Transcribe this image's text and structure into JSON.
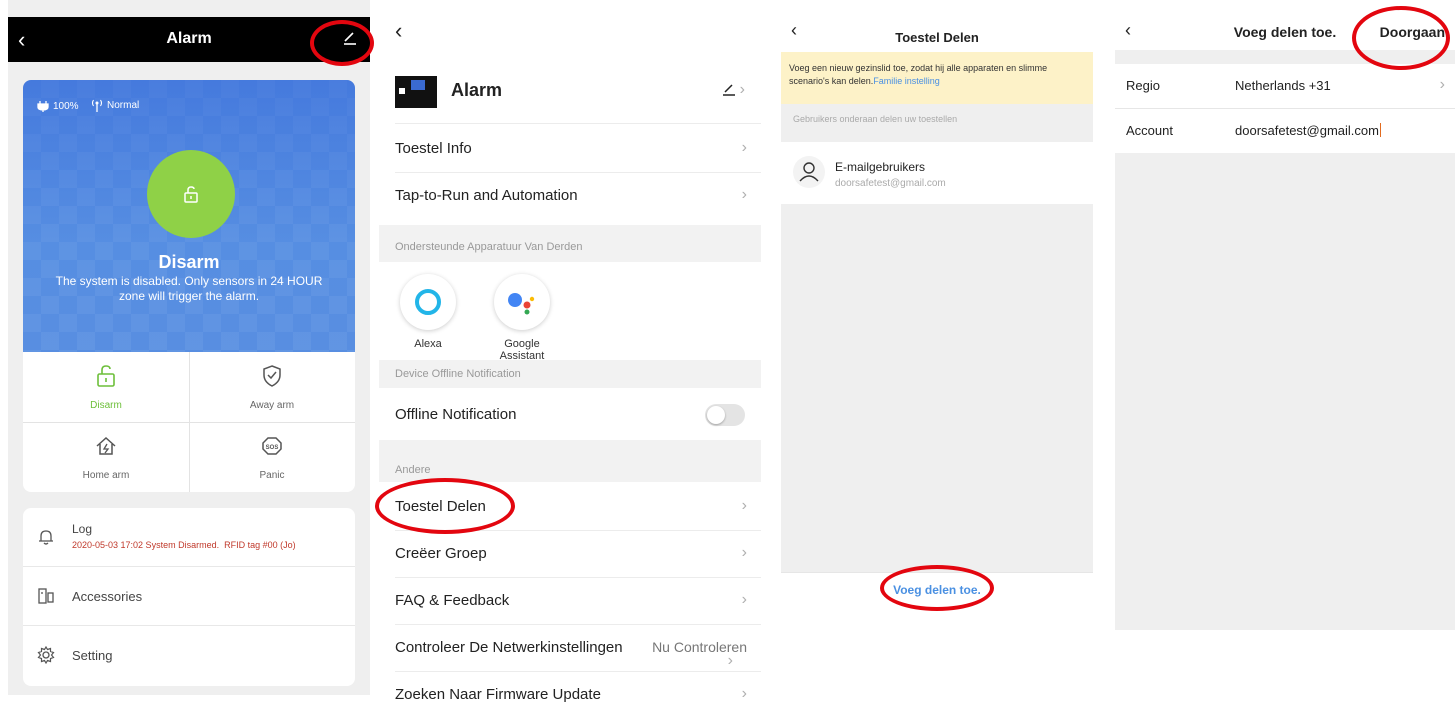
{
  "panel1": {
    "title": "Alarm",
    "battery": "100%",
    "signal": "Normal",
    "state": "Disarm",
    "description": "The system is disabled. Only sensors in 24 HOUR zone will trigger the alarm.",
    "modes": [
      {
        "label": "Disarm",
        "icon": "unlock-icon"
      },
      {
        "label": "Away arm",
        "icon": "shield-check-icon"
      },
      {
        "label": "Home arm",
        "icon": "home-arm-icon"
      },
      {
        "label": "Panic",
        "icon": "sos-icon"
      }
    ],
    "log_label": "Log",
    "log_entry": "2020-05-03 17:02 System Disarmed.  RFID tag #00 (Jo)",
    "accessories_label": "Accessories",
    "setting_label": "Setting",
    "colors": {
      "accent_green": "#8fd147",
      "hero_blue": "#5088de",
      "log_red": "#c0392b"
    }
  },
  "panel2": {
    "device_name": "Alarm",
    "rows_top": [
      "Toestel Info",
      "Tap-to-Run and Automation"
    ],
    "third_party_header": "Ondersteunde Apparatuur Van Derden",
    "assistants": [
      {
        "label": "Alexa"
      },
      {
        "label": "Google Assistant"
      }
    ],
    "offline_header": "Device Offline Notification",
    "offline_label": "Offline Notification",
    "other_header": "Andere",
    "rows_bottom": [
      "Toestel Delen",
      "Creëer Groep",
      "FAQ & Feedback",
      "Controleer De Netwerkinstellingen",
      "Zoeken Naar Firmware Update"
    ],
    "network_action": "Nu Controleren"
  },
  "panel3": {
    "title": "Toestel Delen",
    "notice": "Voeg een nieuw gezinslid toe, zodat hij alle apparaten en slimme scenario's kan delen.",
    "notice_link": "Familie instelling",
    "subheader": "Gebruikers onderaan delen uw toestellen",
    "user_name": "E-mailgebruikers",
    "user_email": "doorsafetest@gmail.com",
    "add_button": "Voeg delen toe."
  },
  "panel4": {
    "title": "Voeg delen toe.",
    "continue_button": "Doorgaan",
    "region_label": "Regio",
    "region_value": "Netherlands +31",
    "account_label": "Account",
    "account_value": "doorsafetest@gmail.com"
  }
}
